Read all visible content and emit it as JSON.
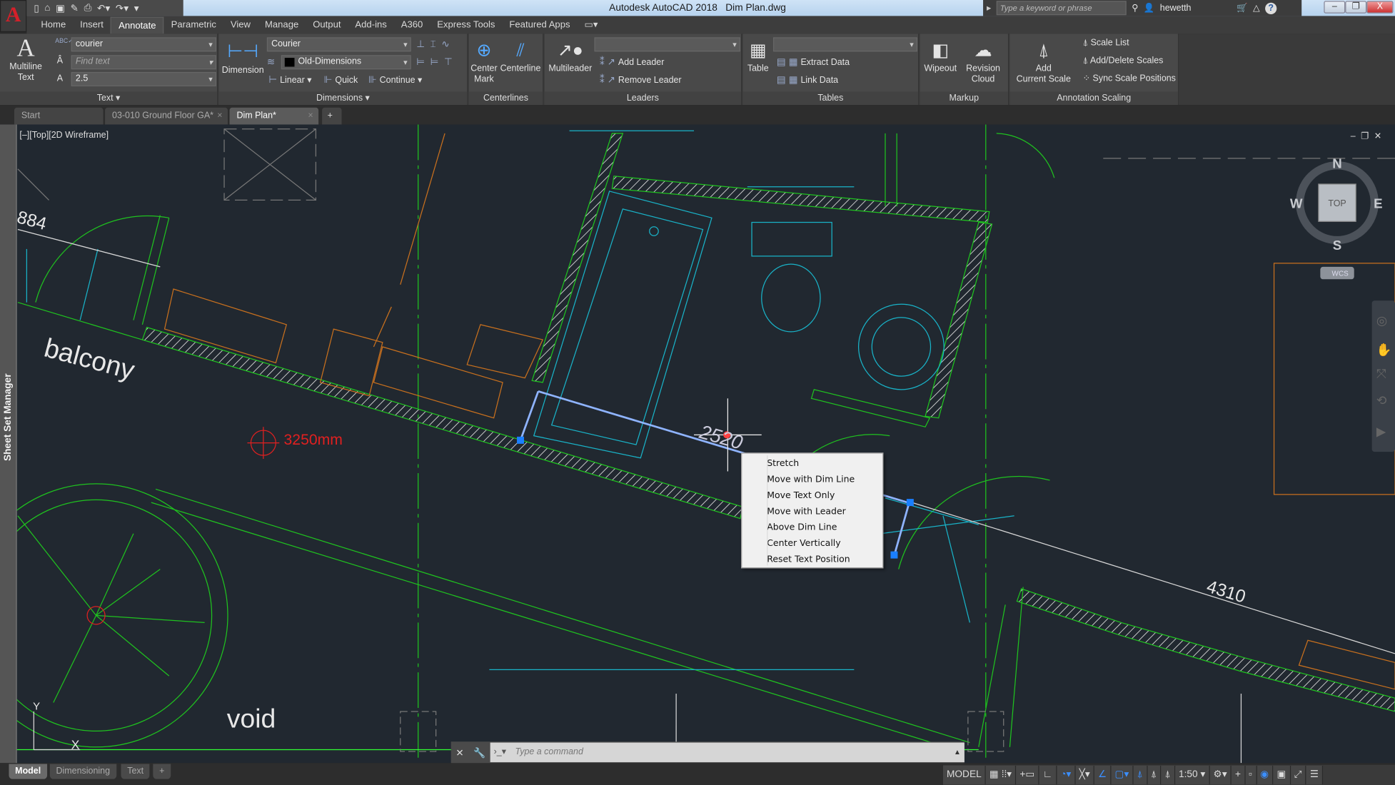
{
  "titlebar": {
    "app_letter": "A",
    "title": "Autodesk AutoCAD 2018",
    "filename": "Dim Plan.dwg",
    "search_placeholder": "Type a keyword or phrase",
    "user": "hewetth",
    "help": "?",
    "min": "–",
    "max": "❐",
    "close": "X"
  },
  "ribbon_tabs": [
    "Home",
    "Insert",
    "Annotate",
    "Parametric",
    "View",
    "Manage",
    "Output",
    "Add-ins",
    "A360",
    "Express Tools",
    "Featured Apps"
  ],
  "active_ribbon_tab": "Annotate",
  "ribbon": {
    "text": {
      "title": "Text ▾",
      "multiline": "Multiline",
      "multiline2": "Text",
      "style": "courier",
      "find_placeholder": "Find text",
      "height": "2.5"
    },
    "dimensions": {
      "title": "Dimensions ▾",
      "dimension": "Dimension",
      "style": "Courier",
      "layer": "Old-Dimensions",
      "linear": "Linear",
      "quick": "Quick",
      "continue": "Continue"
    },
    "centerlines": {
      "title": "Centerlines",
      "center_mark": "Center",
      "center_mark2": "Mark",
      "centerline": "Centerline"
    },
    "leaders": {
      "title": "Leaders",
      "multileader": "Multileader",
      "add_leader": "Add Leader",
      "remove_leader": "Remove Leader"
    },
    "tables": {
      "title": "Tables",
      "table": "Table",
      "extract": "Extract Data",
      "link": "Link Data"
    },
    "markup": {
      "title": "Markup",
      "wipeout": "Wipeout",
      "revision": "Revision",
      "revision2": "Cloud"
    },
    "scaling": {
      "title": "Annotation Scaling",
      "add": "Add",
      "add2": "Current Scale",
      "scale_list": "Scale List",
      "add_delete": "Add/Delete Scales",
      "sync": "Sync Scale Positions"
    }
  },
  "doc_tabs": [
    {
      "label": "Start"
    },
    {
      "label": "03-010 Ground Floor GA*"
    },
    {
      "label": "Dim Plan*"
    }
  ],
  "viewport": {
    "label": "[–][Top][2D Wireframe]",
    "sidebar": "Sheet Set Manager",
    "viewcube": {
      "n": "N",
      "s": "S",
      "e": "E",
      "w": "W",
      "face": "TOP",
      "wcs": "WCS"
    }
  },
  "drawing": {
    "dim_884": "884",
    "balcony": "balcony",
    "void": "void",
    "marker": "3250mm",
    "dim_2520": "2520",
    "dim_4310": "4310",
    "ucs_y": "Y",
    "ucs_x": "X"
  },
  "context_menu": [
    "Stretch",
    "Move with Dim Line",
    "Move Text Only",
    "Move with Leader",
    "Above Dim Line",
    "Center Vertically",
    "Reset Text Position"
  ],
  "command": {
    "placeholder": "Type a command"
  },
  "layout_tabs": [
    "Model",
    "Dimensioning",
    "Text",
    "+"
  ],
  "status": {
    "model": "MODEL",
    "scale": "1:50"
  },
  "colors": {
    "viewport": "#212830",
    "walls": "#1fc21f",
    "fixtures": "#19b3c8",
    "furniture": "#c8701e",
    "dims": "#d8d8d8",
    "marker": "#e02020"
  }
}
